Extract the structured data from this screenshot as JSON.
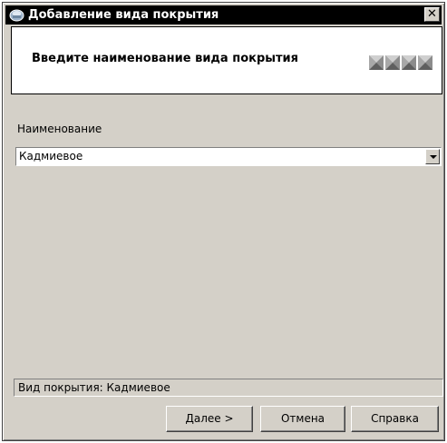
{
  "window": {
    "title": "Добавление вида покрытия",
    "close_glyph": "✕"
  },
  "header": {
    "instruction": "Введите наименование вида покрытия",
    "step_count": 4
  },
  "form": {
    "name_label": "Наименование",
    "name_value": "Кадмиевое"
  },
  "status": {
    "text": "Вид покрытия: Кадмиевое"
  },
  "buttons": {
    "next": "Далее >",
    "cancel": "Отмена",
    "help": "Справка"
  },
  "colors": {
    "dialog_bg": "#d4d0c8",
    "titlebar_bg": "#000000",
    "panel_bg": "#ffffff"
  }
}
